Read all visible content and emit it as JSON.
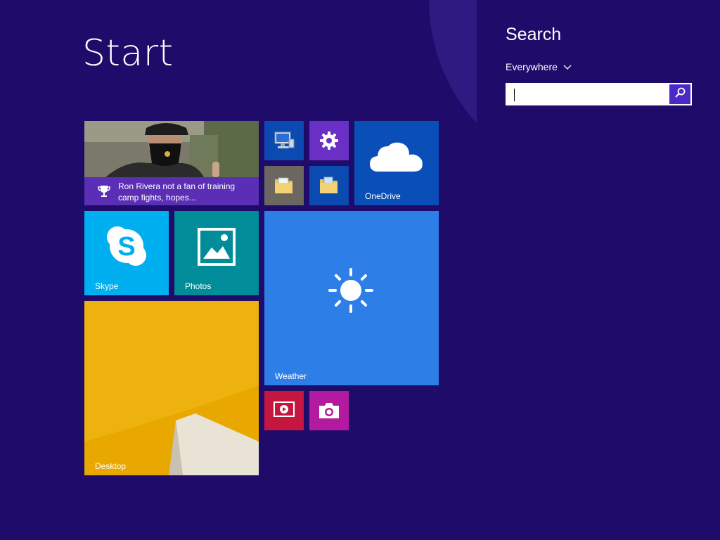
{
  "start": {
    "title": "Start"
  },
  "tiles": {
    "news": {
      "caption": "Ron Rivera not a fan of training camp fights, hopes..."
    },
    "onedrive": {
      "label": "OneDrive"
    },
    "skype": {
      "label": "Skype"
    },
    "photos": {
      "label": "Photos"
    },
    "weather": {
      "label": "Weather"
    },
    "desktop": {
      "label": "Desktop"
    },
    "icons": [
      "computer-icon",
      "gear-icon",
      "folder-icon",
      "folder-icon",
      "cloud-icon",
      "skype-icon",
      "photos-icon",
      "sun-icon",
      "video-icon",
      "camera-icon",
      "trophy-icon"
    ]
  },
  "search": {
    "title": "Search",
    "scope": "Everywhere",
    "value": "",
    "placeholder": ""
  },
  "colors": {
    "background": "#1e0b6a",
    "skype": "#00aff0",
    "photos": "#008c99",
    "weather": "#2e7ee8",
    "desktop": "#e8a800",
    "onedrive": "#0a4fb8",
    "video": "#c4163f",
    "camera": "#b41aa0",
    "news_caption": "#5a2fb5"
  }
}
